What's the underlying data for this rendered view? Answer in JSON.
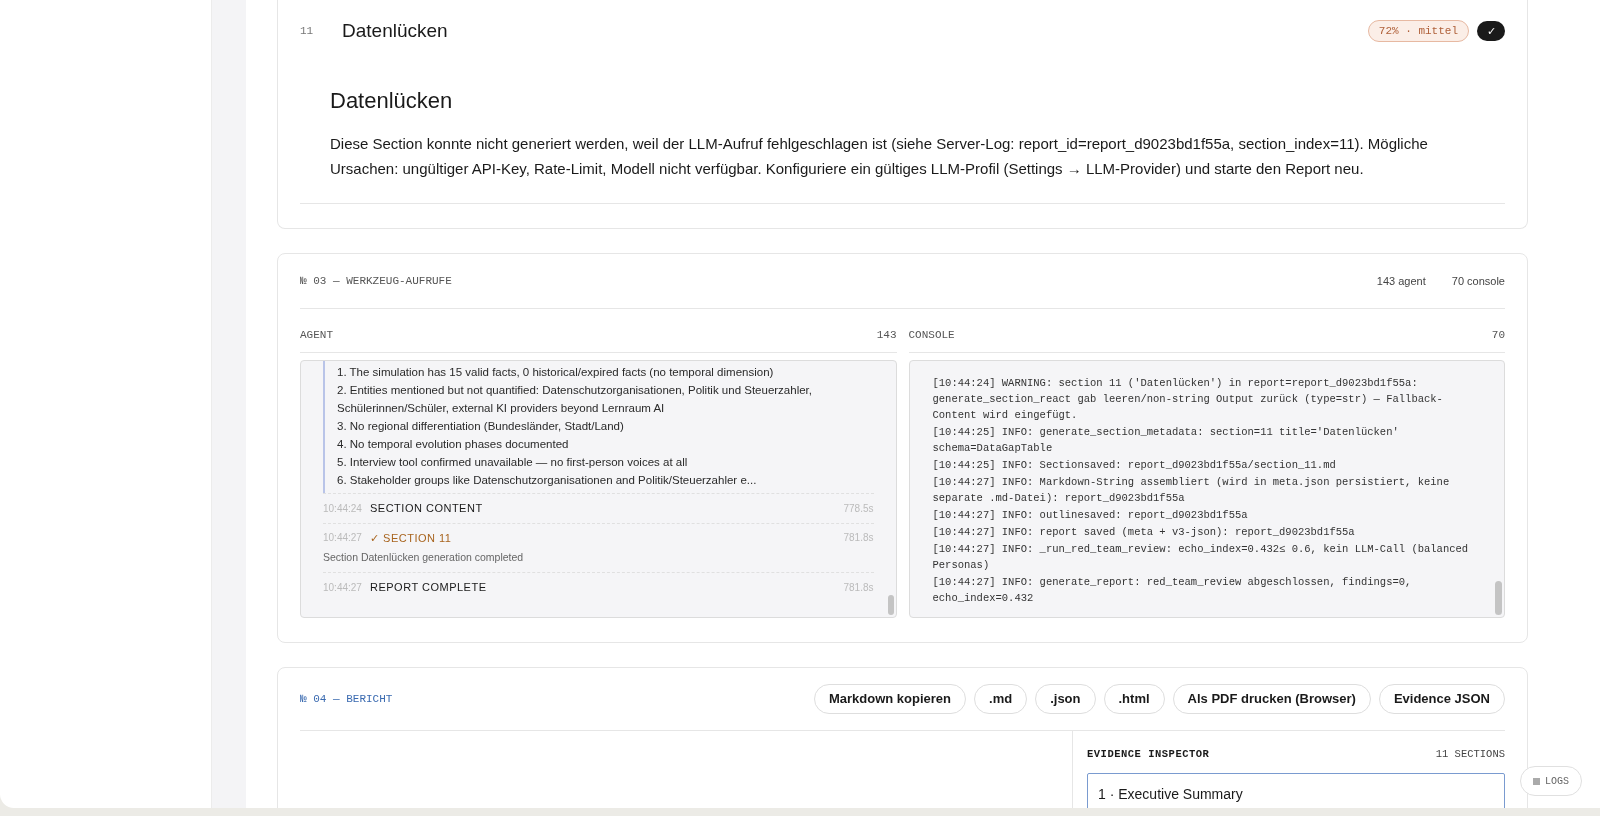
{
  "section_card": {
    "number": "11",
    "title": "Datenlücken",
    "confidence_badge": "72% · mittel",
    "approve_button": {
      "label": "✓",
      "selected": true
    },
    "heading": "Datenlücken",
    "body": "Diese Section konnte nicht generiert werden, weil der LLM-Aufruf fehlgeschlagen ist (siehe Server-Log: report_id=report_d9023bd1f55a, section_index=11). Mögliche Ursachen: ungültiger API-Key, Rate-Limit, Modell nicht verfügbar. Konfiguriere ein gültiges LLM-Profil (Settings → LLM-Provider) und starte den Report neu."
  },
  "tool_calls": {
    "title": "№ 03 — WERKZEUG-AUFRUFE",
    "counts": [
      "143 agent",
      "70 console"
    ],
    "agent": {
      "label": "AGENT",
      "count": "143",
      "quote_lines": [
        "1. The simulation has 15 valid facts, 0 historical/expired facts (no temporal dimension)",
        "2. Entities mentioned but not quantified: Datenschutzorganisationen, Politik und Steuerzahler, Schülerinnen/Schüler, external KI providers beyond Lernraum AI",
        "3. No regional differentiation (Bundesländer, Stadt/Land)",
        "4. No temporal evolution phases documented",
        "5. Interview tool confirmed unavailable — no first-person voices at all",
        "6. Stakeholder groups like Datenschutzorganisationen and Politik/Steuerzahler e..."
      ],
      "events": [
        {
          "time": "10:44:24",
          "label": "SECTION CONTENT",
          "duration": "778.5s",
          "kind": "step"
        },
        {
          "time": "10:44:27",
          "label": "✓ SECTION 11",
          "duration": "781.8s",
          "kind": "success",
          "detail": "Section Datenlücken generation completed"
        },
        {
          "time": "10:44:27",
          "label": "REPORT COMPLETE",
          "duration": "781.8s",
          "kind": "step"
        }
      ]
    },
    "console": {
      "label": "CONSOLE",
      "count": "70",
      "lines": [
        "[10:44:24] WARNING: section 11 ('Datenlücken') in report=report_d9023bd1f55a: generate_section_react gab leeren/non-string Output zurück (type=str) — Fallback-Content wird eingefügt.",
        "[10:44:25] INFO: generate_section_metadata: section=11 title='Datenlücken' schema=DataGapTable",
        "[10:44:25] INFO: Sectionsaved: report_d9023bd1f55a/section_11.md",
        "[10:44:27] INFO: Markdown-String assembliert (wird in meta.json persistiert, keine separate .md-Datei): report_d9023bd1f55a",
        "[10:44:27] INFO: outlinesaved: report_d9023bd1f55a",
        "[10:44:27] INFO: report saved (meta + v3-json): report_d9023bd1f55a",
        "[10:44:27] INFO: _run_red_team_review: echo_index=0.432≤ 0.6, kein LLM-Call (balanced Personas)",
        "[10:44:27] INFO: generate_report: red_team_review abgeschlossen, findings=0, echo_index=0.432"
      ]
    }
  },
  "report": {
    "title": "№ 04 — BERICHT",
    "buttons": [
      "Markdown kopieren",
      ".md",
      ".json",
      ".html",
      "Als PDF drucken (Browser)",
      "Evidence JSON"
    ],
    "inspector": {
      "title": "EVIDENCE INSPECTOR",
      "count": "11 SECTIONS",
      "selected_section": "1 · Executive Summary"
    }
  },
  "logs_button": "LOGS"
}
